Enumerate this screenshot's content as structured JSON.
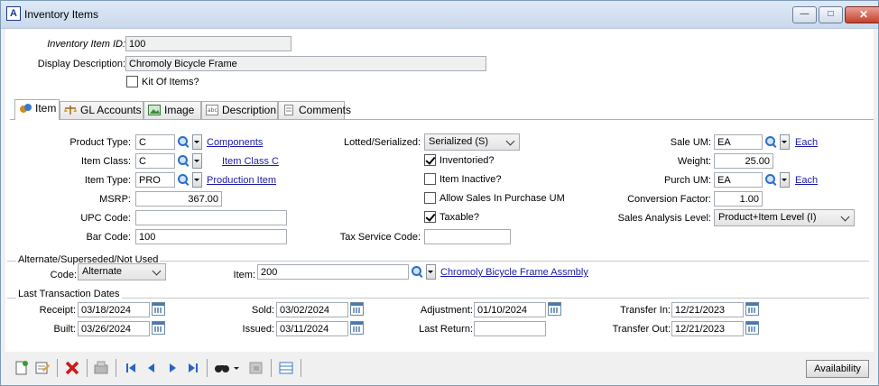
{
  "window": {
    "title": "Inventory Items"
  },
  "header": {
    "item_id_label": "Inventory Item ID:",
    "item_id": "100",
    "display_desc_label": "Display Description:",
    "display_desc": "Chromoly Bicycle Frame",
    "kit_label": "Kit Of Items?",
    "kit_checked": false
  },
  "tabs": [
    {
      "label": "Item",
      "icon": "item-icon",
      "active": true
    },
    {
      "label": "GL Accounts",
      "icon": "scales-icon",
      "active": false
    },
    {
      "label": "Image",
      "icon": "picture-icon",
      "active": false
    },
    {
      "label": "Description",
      "icon": "text-icon",
      "active": false
    },
    {
      "label": "Comments",
      "icon": "document-icon",
      "active": false
    }
  ],
  "item": {
    "product_type_label": "Product Type:",
    "product_type": "C",
    "product_type_link": "Components",
    "item_class_label": "Item Class:",
    "item_class": "C",
    "item_class_link": "Item Class C",
    "item_type_label": "Item Type:",
    "item_type": "PRO",
    "item_type_link": "Production Item",
    "msrp_label": "MSRP:",
    "msrp": "367.00",
    "upc_label": "UPC Code:",
    "upc": "",
    "barcode_label": "Bar Code:",
    "barcode": "100",
    "lotted_label": "Lotted/Serialized:",
    "lotted": "Serialized (S)",
    "inventoried_label": "Inventoried?",
    "inventoried": true,
    "inactive_label": "Item Inactive?",
    "inactive": false,
    "allow_sales_label": "Allow Sales In Purchase UM",
    "allow_sales": false,
    "taxable_label": "Taxable?",
    "taxable": true,
    "tax_service_label": "Tax Service Code:",
    "tax_service": "",
    "sale_um_label": "Sale UM:",
    "sale_um": "EA",
    "sale_um_link": "Each",
    "weight_label": "Weight:",
    "weight": "25.00",
    "purch_um_label": "Purch UM:",
    "purch_um": "EA",
    "purch_um_link": "Each",
    "conversion_label": "Conversion Factor:",
    "conversion": "1.00",
    "sales_analysis_label": "Sales Analysis Level:",
    "sales_analysis": "Product+Item Level (I)"
  },
  "alternate": {
    "group_title": "Alternate/Superseded/Not Used",
    "code_label": "Code:",
    "code": "Alternate",
    "item_label": "Item:",
    "item": "200",
    "item_link": "Chromoly Bicycle Frame Assmbly"
  },
  "last_trans": {
    "group_title": "Last Transaction Dates",
    "receipt_label": "Receipt:",
    "receipt": "03/18/2024",
    "built_label": "Built:",
    "built": "03/26/2024",
    "sold_label": "Sold:",
    "sold": "03/02/2024",
    "issued_label": "Issued:",
    "issued": "03/11/2024",
    "adjustment_label": "Adjustment:",
    "adjustment": "01/10/2024",
    "last_return_label": "Last Return:",
    "last_return": "",
    "transfer_in_label": "Transfer In:",
    "transfer_in": "12/21/2023",
    "transfer_out_label": "Transfer Out:",
    "transfer_out": "12/21/2023"
  },
  "toolbar": {
    "availability_label": "Availability",
    "icons": [
      "new-icon",
      "save-icon",
      "delete-icon",
      "print-icon",
      "first-record-icon",
      "previous-record-icon",
      "next-record-icon",
      "last-record-icon",
      "find-icon",
      "filter-icon",
      "list-icon"
    ]
  },
  "colors": {
    "link": "#1a1aa8",
    "title_bar": "#c9d9ec",
    "close_button": "#c4402a"
  }
}
